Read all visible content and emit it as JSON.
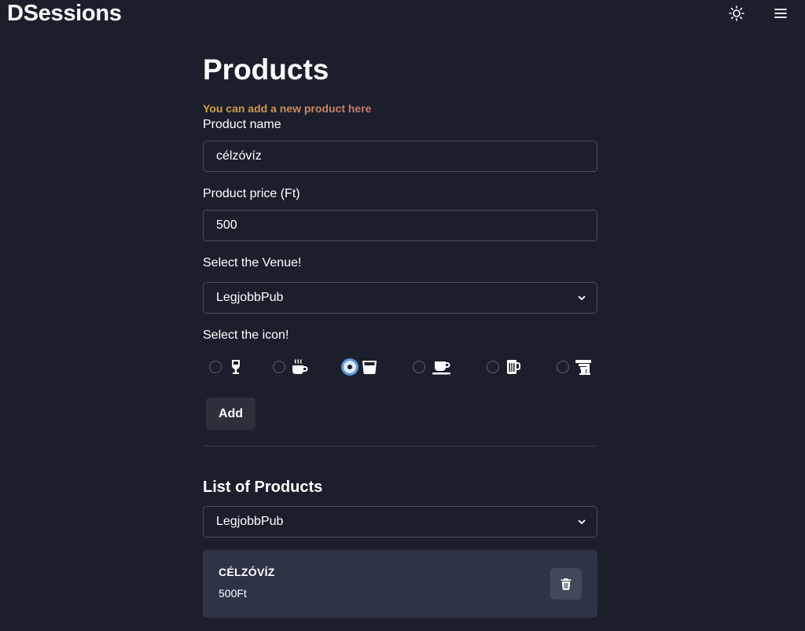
{
  "app": {
    "title": "DSessions"
  },
  "header": {
    "theme_icon": "sun-icon",
    "menu_icon": "hamburger-menu-icon"
  },
  "page": {
    "title": "Products",
    "subtitle": "You can add a new product here",
    "subtitle_colors": [
      "#d4a53a",
      "#c77a74"
    ]
  },
  "form": {
    "name_label": "Product name",
    "name_value": "célzóvíz",
    "price_label": "Product price (Ft)",
    "price_value": "500",
    "venue_label": "Select the Venue!",
    "venue_value": "LegjobbPub",
    "icon_label": "Select the icon!",
    "icons": [
      {
        "name": "wine-glass-icon",
        "checked": false
      },
      {
        "name": "hot-mug-icon",
        "checked": false
      },
      {
        "name": "shot-glass-icon",
        "checked": true
      },
      {
        "name": "coffee-cup-saucer-icon",
        "checked": false
      },
      {
        "name": "beer-mug-icon",
        "checked": false
      },
      {
        "name": "espresso-machine-icon",
        "checked": false
      }
    ],
    "add_label": "Add"
  },
  "list": {
    "title": "List of Products",
    "filter_value": "LegjobbPub",
    "items": [
      {
        "name": "célzóvíz",
        "price": "500Ft",
        "delete_icon": "trash-icon"
      }
    ]
  },
  "colors": {
    "background": "#1b1f2b",
    "card": "#2d3446",
    "accent_radio": "#5b95d6",
    "border": "#4a4f5c"
  }
}
